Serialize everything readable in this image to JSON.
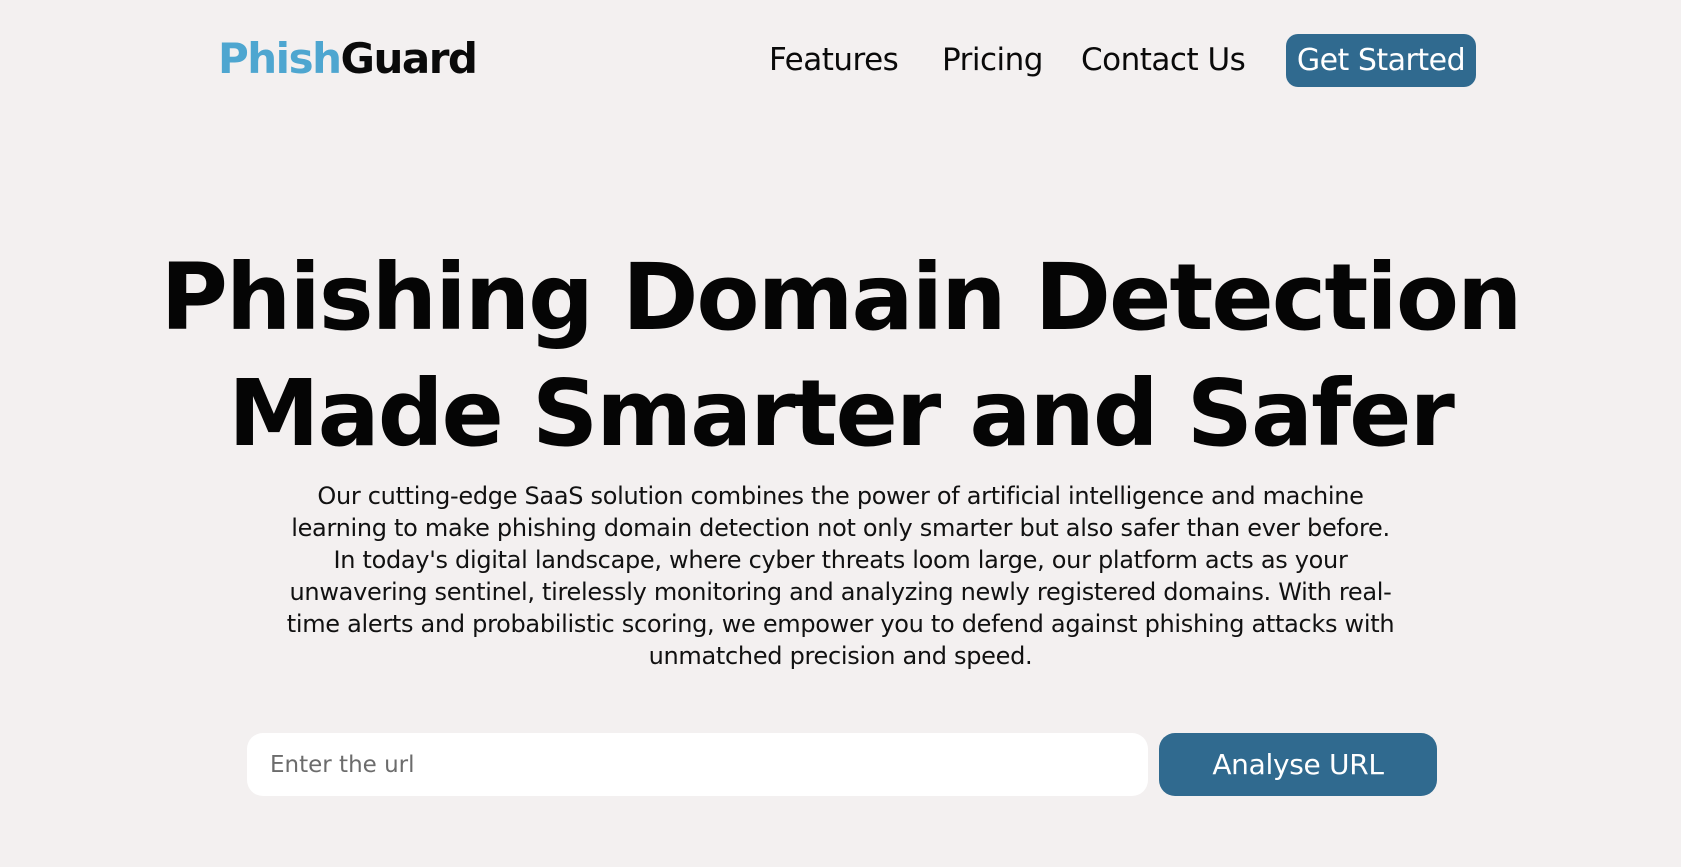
{
  "brand": {
    "name_part_a": "Phish",
    "name_part_b": "Guard",
    "accent_color": "#4ea6d0",
    "button_color": "#306a8f",
    "background_color": "#f3f0f0"
  },
  "nav": {
    "links": [
      {
        "label": "Features"
      },
      {
        "label": "Pricing"
      },
      {
        "label": "Contact Us"
      }
    ],
    "cta_label": "Get Started"
  },
  "hero": {
    "title_line_1": "Phishing Domain Detection",
    "title_line_2": "Made Smarter and Safer",
    "description": "Our cutting-edge SaaS solution combines the power of artificial intelligence and machine learning to make phishing domain detection not only smarter but also safer than ever before. In today's digital landscape, where cyber threats loom large, our platform acts as your unwavering sentinel, tirelessly monitoring and analyzing newly registered domains. With real-time alerts and probabilistic scoring, we empower you to defend against phishing attacks with unmatched precision and speed."
  },
  "analyse_form": {
    "input_value": "",
    "input_placeholder": "Enter the url",
    "button_label": "Analyse URL"
  }
}
